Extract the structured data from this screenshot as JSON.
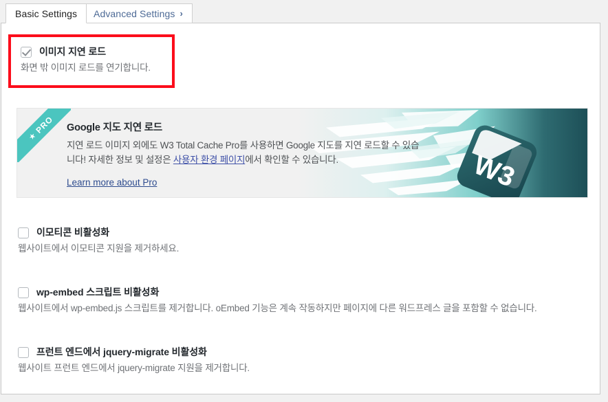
{
  "tabs": [
    {
      "label": "Basic Settings",
      "active": true,
      "name": "tab-basic-settings"
    },
    {
      "label": "Advanced Settings",
      "active": false,
      "chevron": "›",
      "name": "tab-advanced-settings"
    }
  ],
  "highlight": {
    "border_color": "#fc0d1b"
  },
  "options": [
    {
      "title": "이미지 지연 로드",
      "description": "화면 밖 이미지 로드를 연기합니다.",
      "checked": true
    },
    {
      "title": "이모티콘 비활성화",
      "description": "웹사이트에서 이모티콘 지원을 제거하세요.",
      "checked": false
    },
    {
      "title": "wp-embed 스크립트 비활성화",
      "description": "웹사이트에서 wp-embed.js 스크립트를 제거합니다. oEmbed 기능은 계속 작동하지만 페이지에 다른 워드프레스 글을 포함할 수 없습니다.",
      "checked": false
    },
    {
      "title": "프런트 엔드에서 jquery-migrate 비활성화",
      "description": "웹사이트 프런트 엔드에서 jquery-migrate 지원을 제거합니다.",
      "checked": false
    }
  ],
  "pro_banner": {
    "ribbon_label": "PRO",
    "ribbon_star": "★",
    "title": "Google 지도 지연 로드",
    "body_part1": "지연 로드 이미지 외에도 W3 Total Cache Pro를 사용하면 Google 지도를 지연 로드할 수 있습니다! 자세한 정보 및 설정은 ",
    "body_link": "사용자 환경 페이지",
    "body_part2": "에서 확인할 수 있습니다.",
    "cta_label": "Learn more about Pro",
    "accent_color": "#4bc5bf",
    "logo_text": "W3"
  }
}
